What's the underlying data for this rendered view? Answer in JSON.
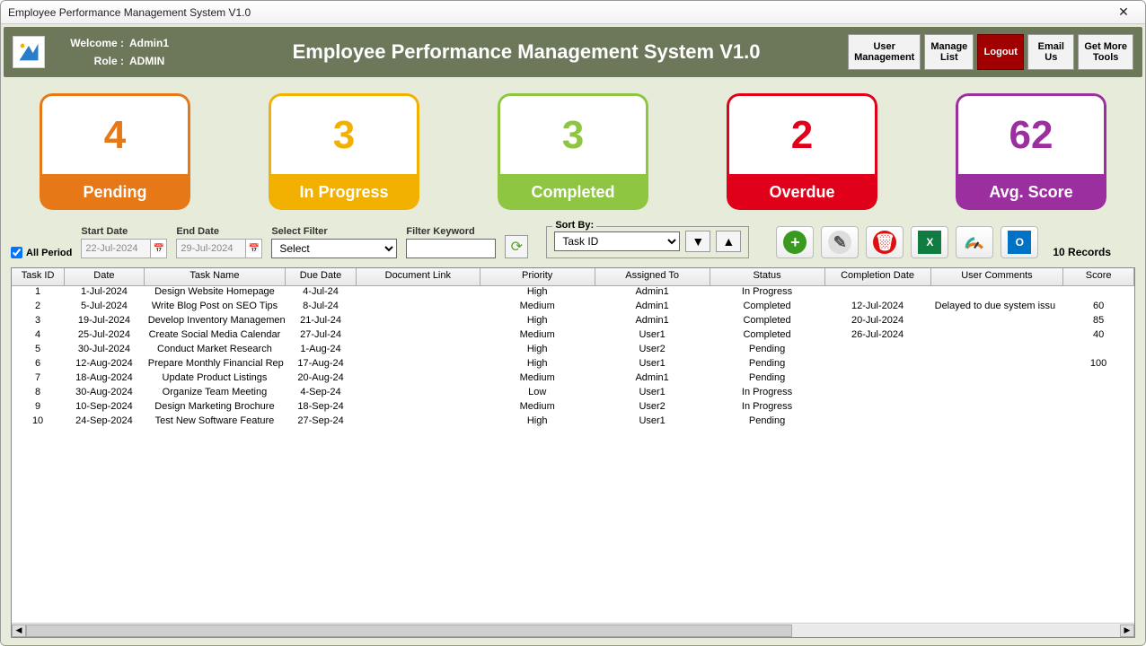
{
  "window_title": "Employee Performance Management System V1.0",
  "header": {
    "welcome_label": "Welcome :",
    "welcome_value": "Admin1",
    "role_label": "Role :",
    "role_value": "ADMIN",
    "app_title": "Employee Performance Management System V1.0",
    "buttons": {
      "user_mgmt": "User\nManagement",
      "manage_list": "Manage\nList",
      "logout": "Logout",
      "email_us": "Email\nUs",
      "get_more": "Get More\nTools"
    }
  },
  "cards": {
    "pending": {
      "count": "4",
      "label": "Pending"
    },
    "in_progress": {
      "count": "3",
      "label": "In Progress"
    },
    "completed": {
      "count": "3",
      "label": "Completed"
    },
    "overdue": {
      "count": "2",
      "label": "Overdue"
    },
    "avg_score": {
      "count": "62",
      "label": "Avg. Score"
    }
  },
  "filters": {
    "all_period": "All Period",
    "start_date_label": "Start Date",
    "start_date": "22-Jul-2024",
    "end_date_label": "End Date",
    "end_date": "29-Jul-2024",
    "select_filter_label": "Select Filter",
    "select_filter_value": "Select",
    "filter_keyword_label": "Filter Keyword",
    "sort_by_label": "Sort By:",
    "sort_by_value": "Task ID",
    "records": "10 Records"
  },
  "columns": [
    "Task ID",
    "Date",
    "Task Name",
    "Due Date",
    "Document Link",
    "Priority",
    "Assigned To",
    "Status",
    "Completion Date",
    "User Comments",
    "Score"
  ],
  "rows": [
    {
      "id": "1",
      "date": "1-Jul-2024",
      "name": "Design Website Homepage",
      "due": "4-Jul-24",
      "doc": "",
      "priority": "High",
      "assigned": "Admin1",
      "status": "In Progress",
      "comp": "",
      "comments": "",
      "score": ""
    },
    {
      "id": "2",
      "date": "5-Jul-2024",
      "name": "Write Blog Post on SEO Tips",
      "due": "8-Jul-24",
      "doc": "",
      "priority": "Medium",
      "assigned": "Admin1",
      "status": "Completed",
      "comp": "12-Jul-2024",
      "comments": "Delayed to due system issu",
      "score": "60"
    },
    {
      "id": "3",
      "date": "19-Jul-2024",
      "name": "Develop Inventory Managemen",
      "due": "21-Jul-24",
      "doc": "",
      "priority": "High",
      "assigned": "Admin1",
      "status": "Completed",
      "comp": "20-Jul-2024",
      "comments": "",
      "score": "85"
    },
    {
      "id": "4",
      "date": "25-Jul-2024",
      "name": "Create Social Media Calendar",
      "due": "27-Jul-24",
      "doc": "",
      "priority": "Medium",
      "assigned": "User1",
      "status": "Completed",
      "comp": "26-Jul-2024",
      "comments": "",
      "score": "40"
    },
    {
      "id": "5",
      "date": "30-Jul-2024",
      "name": "Conduct Market Research",
      "due": "1-Aug-24",
      "doc": "",
      "priority": "High",
      "assigned": "User2",
      "status": "Pending",
      "comp": "",
      "comments": "",
      "score": ""
    },
    {
      "id": "6",
      "date": "12-Aug-2024",
      "name": "Prepare Monthly Financial Rep",
      "due": "17-Aug-24",
      "doc": "",
      "priority": "High",
      "assigned": "User1",
      "status": "Pending",
      "comp": "",
      "comments": "",
      "score": "100"
    },
    {
      "id": "7",
      "date": "18-Aug-2024",
      "name": "Update Product Listings",
      "due": "20-Aug-24",
      "doc": "",
      "priority": "Medium",
      "assigned": "Admin1",
      "status": "Pending",
      "comp": "",
      "comments": "",
      "score": ""
    },
    {
      "id": "8",
      "date": "30-Aug-2024",
      "name": "Organize Team Meeting",
      "due": "4-Sep-24",
      "doc": "",
      "priority": "Low",
      "assigned": "User1",
      "status": "In Progress",
      "comp": "",
      "comments": "",
      "score": ""
    },
    {
      "id": "9",
      "date": "10-Sep-2024",
      "name": "Design Marketing Brochure",
      "due": "18-Sep-24",
      "doc": "",
      "priority": "Medium",
      "assigned": "User2",
      "status": "In Progress",
      "comp": "",
      "comments": "",
      "score": ""
    },
    {
      "id": "10",
      "date": "24-Sep-2024",
      "name": "Test New Software Feature",
      "due": "27-Sep-24",
      "doc": "",
      "priority": "High",
      "assigned": "User1",
      "status": "Pending",
      "comp": "",
      "comments": "",
      "score": ""
    }
  ]
}
